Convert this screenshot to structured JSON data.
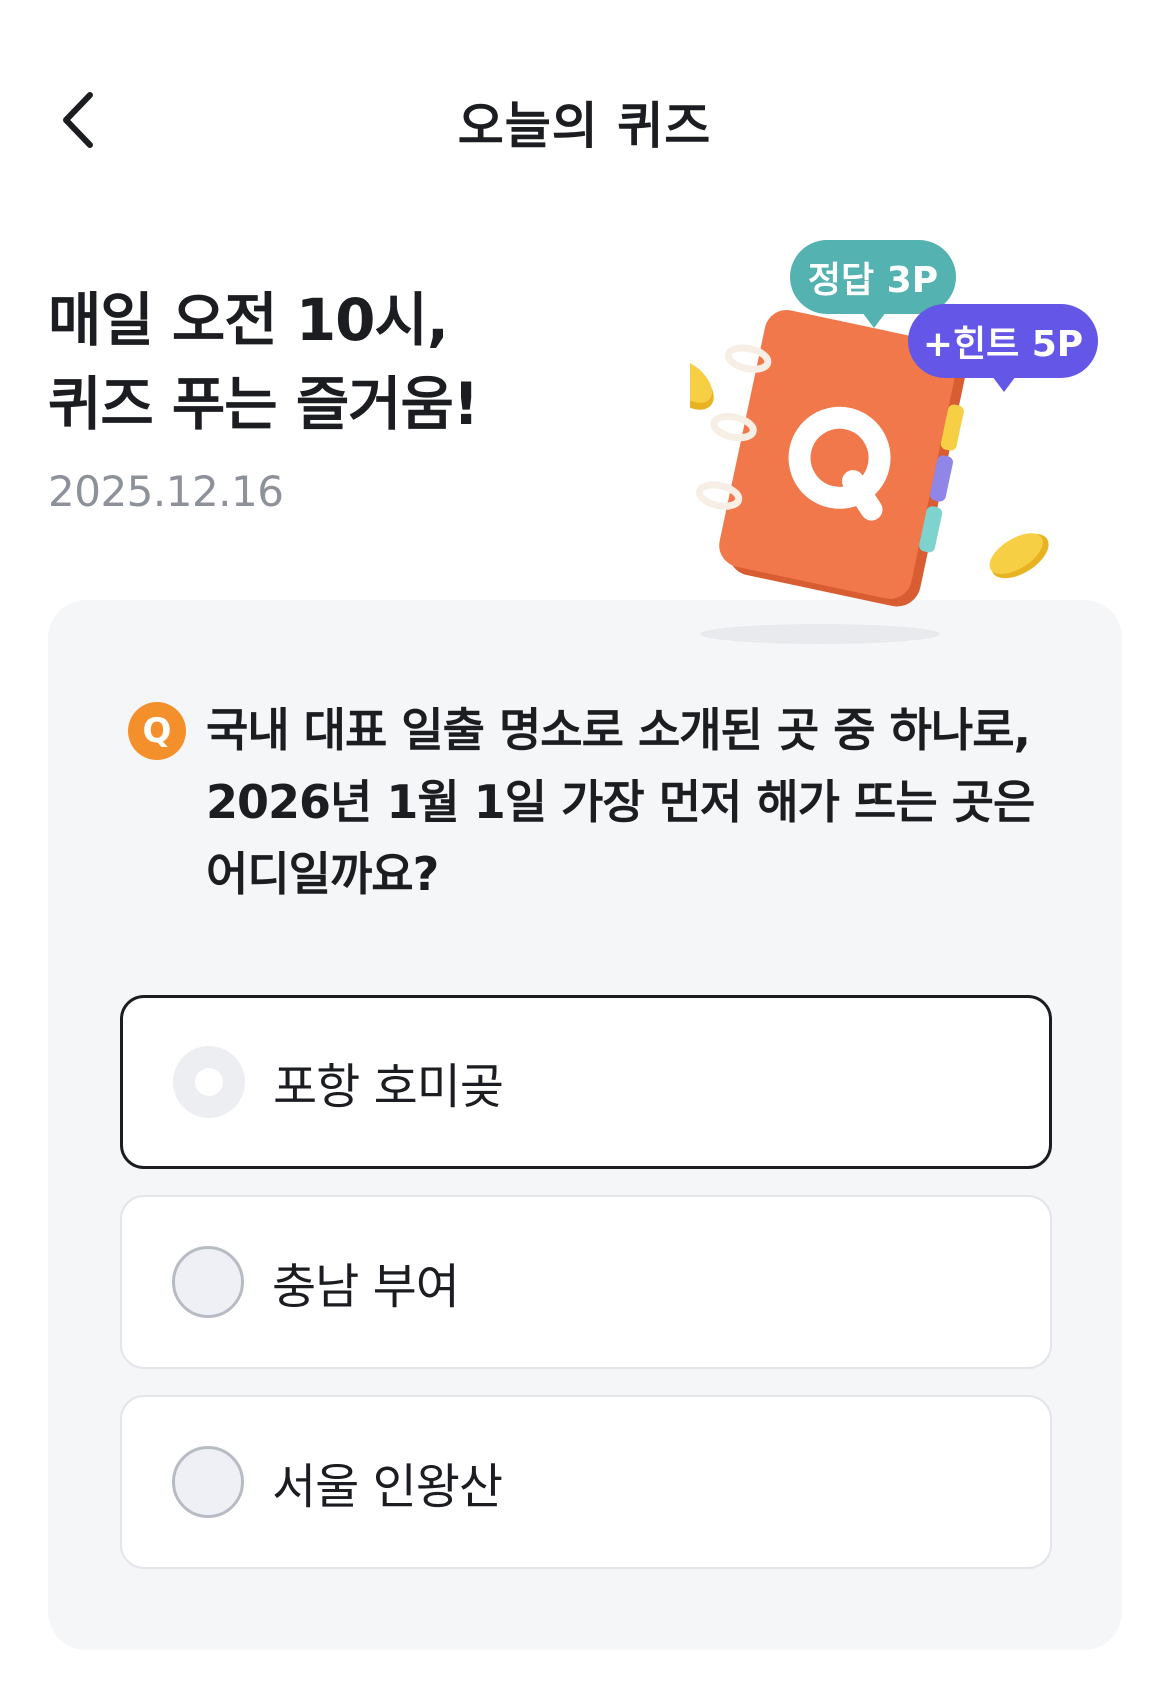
{
  "header": {
    "title": "오늘의 퀴즈"
  },
  "hero": {
    "line1": "매일 오전 10시,",
    "line2": "퀴즈 푸는 즐거움!",
    "date": "2025.12.16"
  },
  "badges": {
    "answer_points": "정답 3P",
    "hint_points": "+힌트 5P"
  },
  "question": {
    "badge": "Q",
    "text": "국내 대표 일출 명소로 소개된 곳 중 하나로, 2026년 1월 1일 가장 먼저 해가 뜨는 곳은 어디일까요?"
  },
  "options": [
    {
      "label": "포항 호미곶",
      "selected": true
    },
    {
      "label": "충남 부여",
      "selected": false
    },
    {
      "label": "서울 인왕산",
      "selected": false
    }
  ],
  "colors": {
    "accent_orange": "#f4902b",
    "answer_badge": "#54b2b0",
    "hint_badge": "#6457e8",
    "notebook": "#f0784a",
    "coin": "#f6c93a"
  }
}
